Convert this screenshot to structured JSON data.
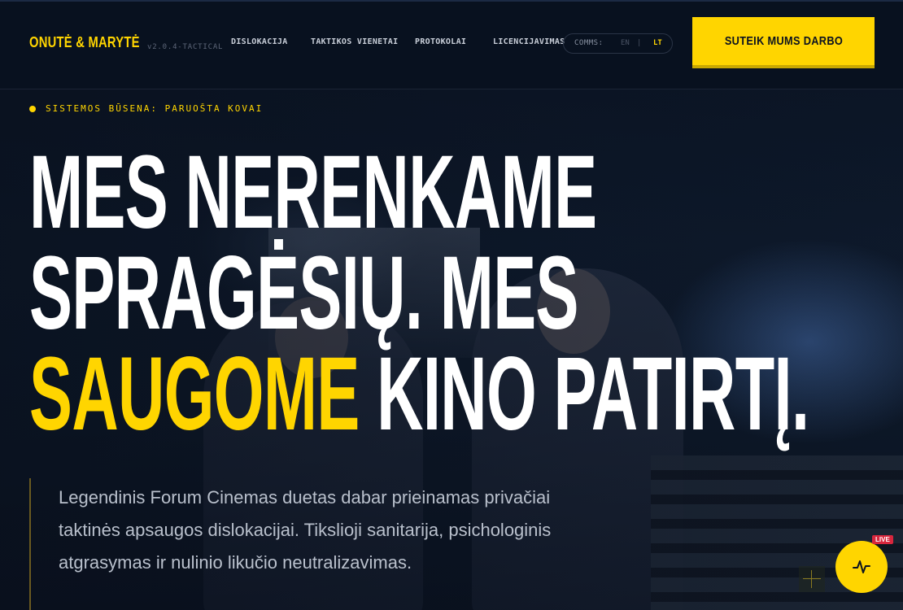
{
  "brand": {
    "name": "ONUTĖ & MARYTĖ",
    "version": "v2.0.4-TACTICAL"
  },
  "nav": {
    "items": [
      {
        "label": "DISLOKACIJA"
      },
      {
        "label": "TAKTIKOS VIENETAI"
      },
      {
        "label": "PROTOKOLAI"
      },
      {
        "label": "LICENCIJAVIMAS"
      }
    ],
    "comms": {
      "label": "COMMS:",
      "en": "EN",
      "separator": "|",
      "lt": "LT",
      "active": "LT"
    },
    "cta_label": "SUTEIK MUMS DARBO"
  },
  "hero": {
    "status": "SISTEMOS BŪSENA: PARUOŠTA KOVAI",
    "headline": {
      "line1": "MES NERENKAME",
      "line2": "SPRAGĖSIŲ. MES",
      "line3_highlight": "SAUGOME",
      "line3_rest": " KINO PATIRTĮ."
    },
    "lead": "Legendinis Forum Cinemas duetas dabar prieinamas privačiai taktinės apsaugos dislokacijai. Tiksliojі sanitarija, psichologinis atgrasymas ir nulinio likučio neutralizavimas."
  },
  "live_widget": {
    "badge": "LIVE",
    "icon": "activity-icon"
  },
  "colors": {
    "accent": "#ffd500",
    "background": "#08111f",
    "live": "#d7263d"
  }
}
